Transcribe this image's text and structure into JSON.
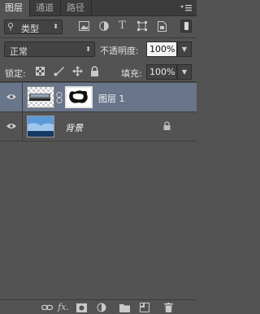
{
  "tabs": [
    {
      "label": "图层",
      "active": true
    },
    {
      "label": "通道",
      "active": false
    },
    {
      "label": "路径",
      "active": false
    }
  ],
  "filter": {
    "kind_label": "类型",
    "icons": [
      "image-filter-icon",
      "adjustment-filter-icon",
      "type-filter-icon",
      "shape-filter-icon",
      "smart-object-filter-icon"
    ]
  },
  "blend": {
    "mode": "正常",
    "opacity_label": "不透明度:",
    "opacity_value": "100%"
  },
  "lock": {
    "label": "锁定:",
    "fill_label": "填充:",
    "fill_value": "100%"
  },
  "layers": [
    {
      "name": "图层 1",
      "selected": true,
      "visible": true,
      "has_mask": true,
      "locked": false
    },
    {
      "name": "背景",
      "selected": false,
      "visible": true,
      "has_mask": false,
      "locked": true
    }
  ],
  "bottom_icons": [
    "link-layers-icon",
    "fx-icon",
    "add-mask-icon",
    "adjustment-layer-icon",
    "new-group-icon",
    "new-layer-icon",
    "delete-layer-icon"
  ],
  "colors": {
    "panel_bg": "#535353",
    "selected_row": "#68758a",
    "tab_bar": "#3c3c3c"
  }
}
